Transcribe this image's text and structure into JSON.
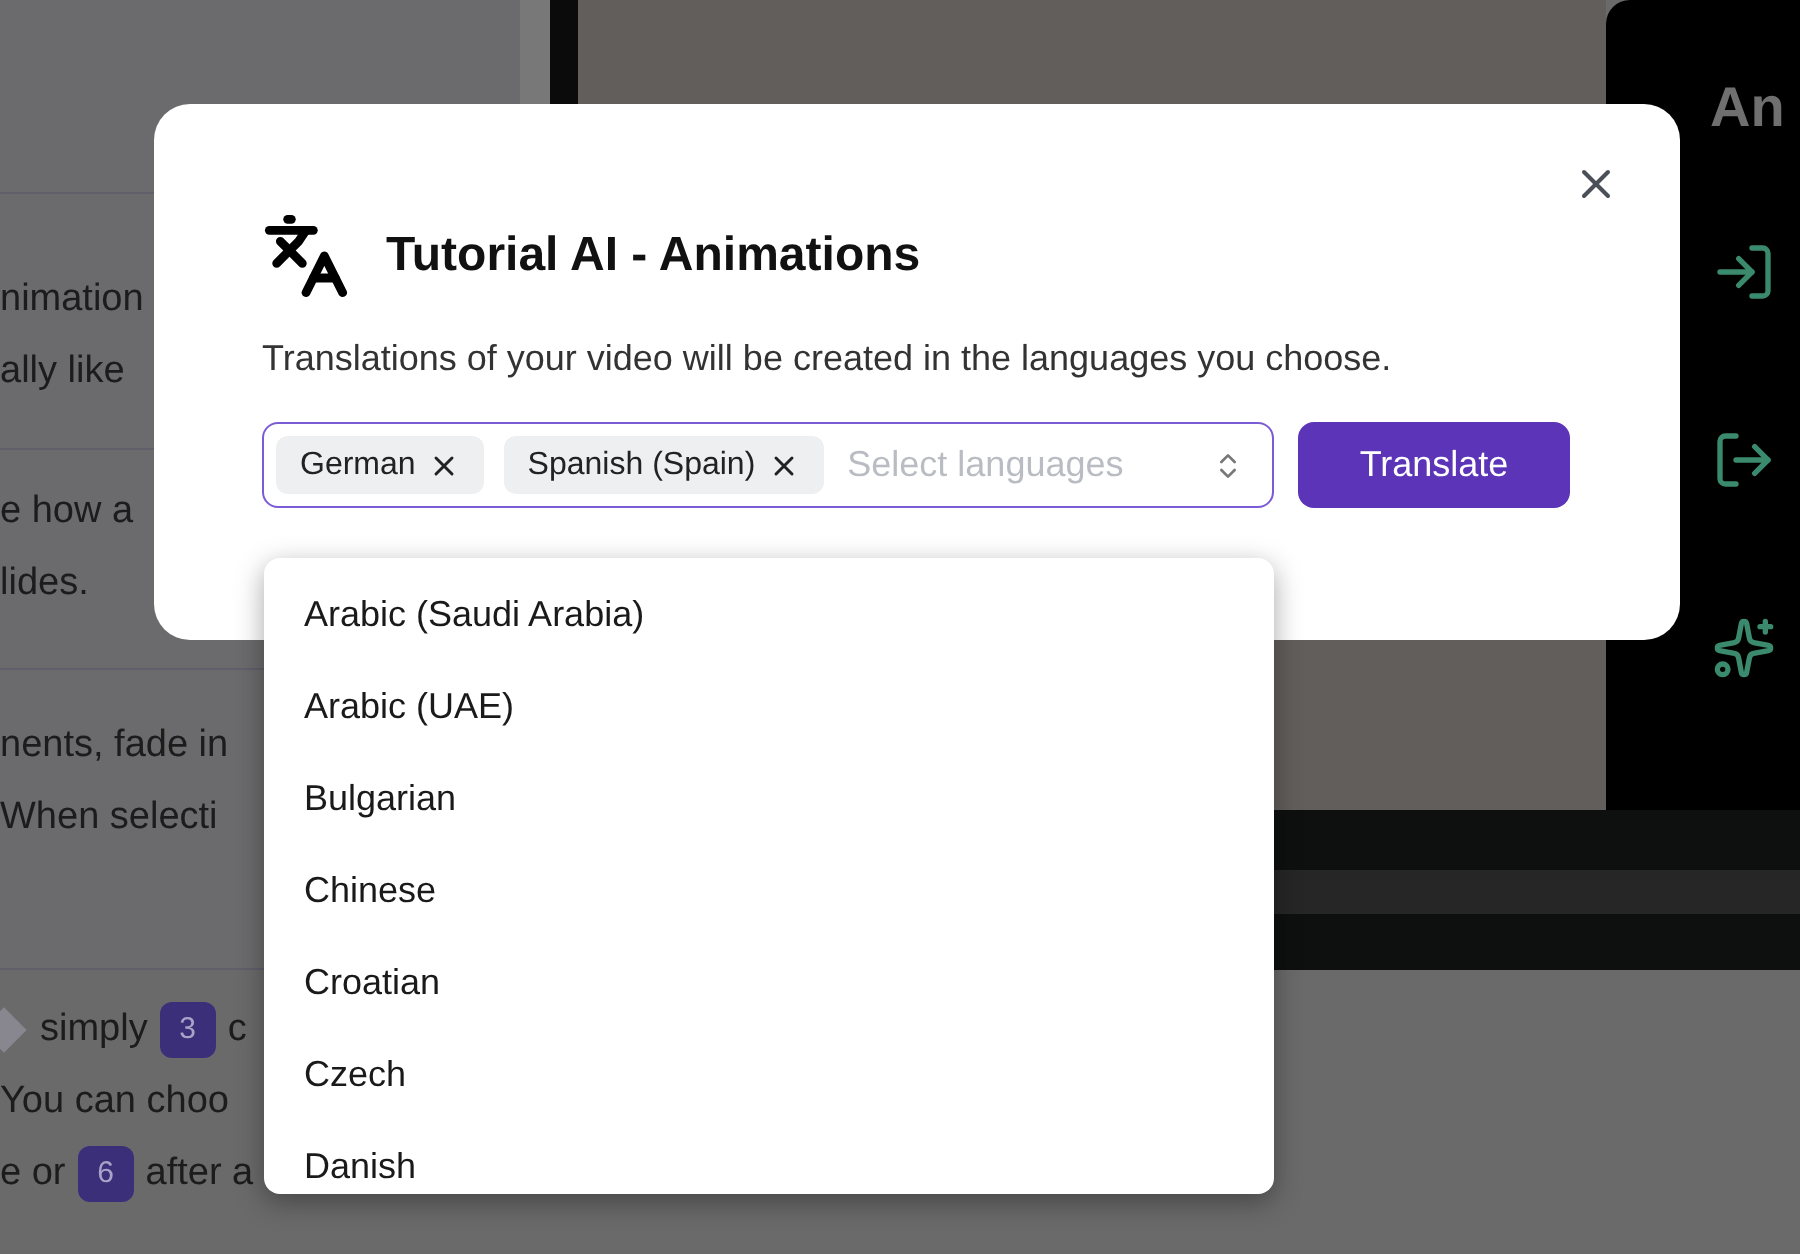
{
  "editor": {
    "paragraphs": [
      {
        "lines": [
          "nimation",
          "ally like"
        ]
      },
      {
        "lines": [
          "e how a",
          "lides."
        ]
      },
      {
        "lines": [
          "nents, fade in",
          "When selecti"
        ]
      }
    ],
    "bottom_lines": [
      [
        {
          "kind": "marker"
        },
        {
          "kind": "text",
          "text": "simply"
        },
        {
          "kind": "badge",
          "text": "3"
        },
        {
          "kind": "text",
          "text": "c"
        }
      ],
      [
        {
          "kind": "text",
          "text": "You can choo"
        }
      ],
      [
        {
          "kind": "text",
          "text": "e or"
        },
        {
          "kind": "badge",
          "text": "6"
        },
        {
          "kind": "text",
          "text": "after a"
        }
      ]
    ]
  },
  "side_panel": {
    "title": "An",
    "actions": [
      {
        "kind": "enter"
      },
      {
        "kind": "exit"
      },
      {
        "kind": "sparkles"
      }
    ]
  },
  "dialog": {
    "title": "Tutorial AI - Animations",
    "description": "Translations of your video will be created in the languages you choose.",
    "selected_languages": [
      "German",
      "Spanish (Spain)"
    ],
    "placeholder": "Select languages",
    "button": "Translate",
    "dropdown_open": true,
    "options": [
      "Arabic (Saudi Arabia)",
      "Arabic (UAE)",
      "Bulgarian",
      "Chinese",
      "Croatian",
      "Czech",
      "Danish"
    ]
  }
}
